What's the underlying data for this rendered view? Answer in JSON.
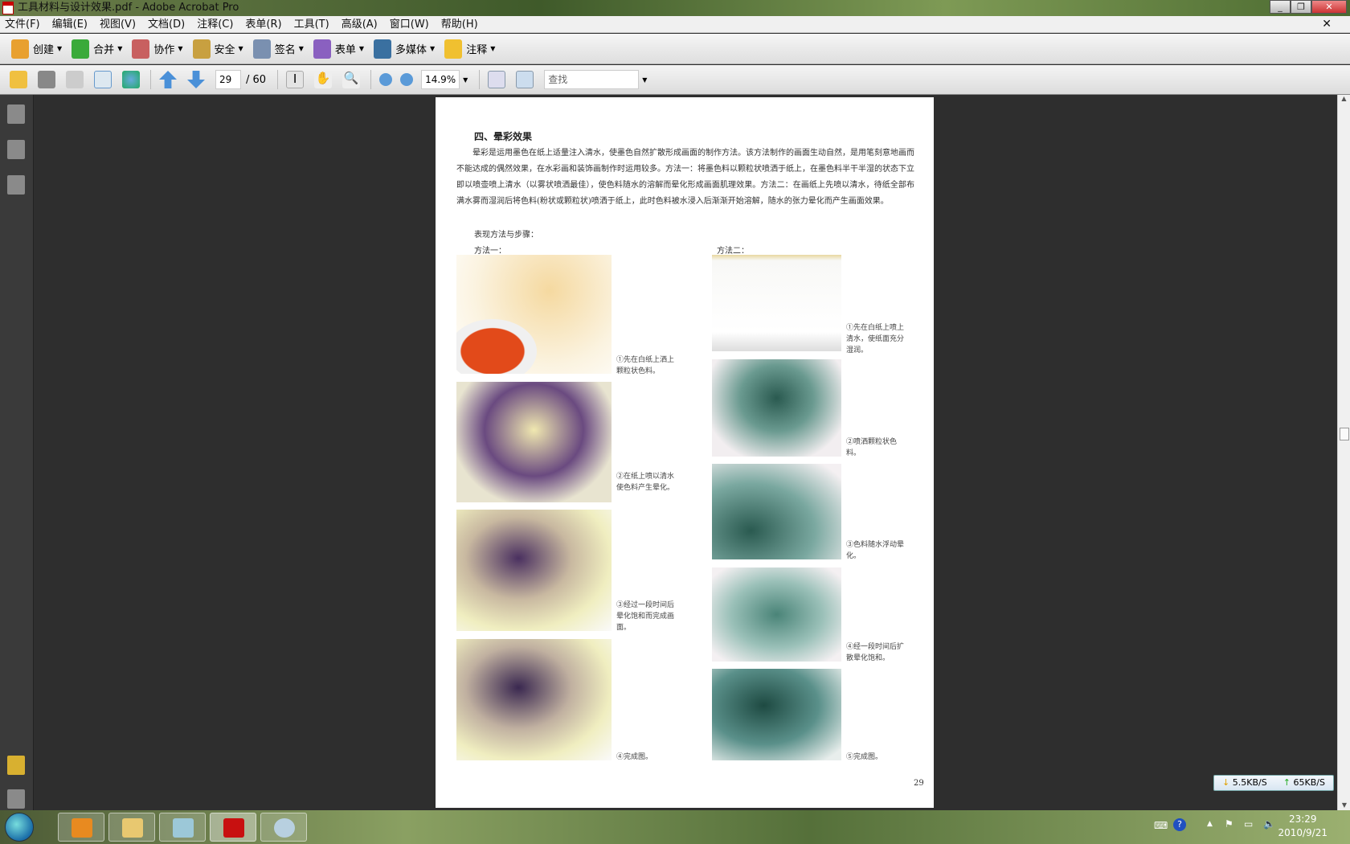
{
  "window": {
    "title": "工具材料与设计效果.pdf - Adobe Acrobat Pro",
    "min": "0",
    "max": "1",
    "close": "r",
    "menu_close": "×"
  },
  "menu": [
    "文件(F)",
    "编辑(E)",
    "视图(V)",
    "文档(D)",
    "注释(C)",
    "表单(R)",
    "工具(T)",
    "高级(A)",
    "窗口(W)",
    "帮助(H)"
  ],
  "toolbar1": [
    {
      "label": "创建",
      "color": "#e8a030"
    },
    {
      "label": "合并",
      "color": "#3aaa3a"
    },
    {
      "label": "协作",
      "color": "#c86060"
    },
    {
      "label": "安全",
      "color": "#c8a040"
    },
    {
      "label": "签名",
      "color": "#7a90b0"
    },
    {
      "label": "表单",
      "color": "#8a60c0"
    },
    {
      "label": "多媒体",
      "color": "#3a70a0"
    },
    {
      "label": "注释",
      "color": "#f0c030"
    }
  ],
  "toolbar2": {
    "page_current": "29",
    "page_total": "/ 60",
    "zoom": "14.9%",
    "find_placeholder": "查找"
  },
  "document": {
    "heading": "四、晕彩效果",
    "paragraph": "晕彩是运用墨色在纸上适量注入清水，使墨色自然扩散形成画面的制作方法。该方法制作的画面生动自然，是用笔刻意地画而不能达成的偶然效果，在水彩画和装饰画制作时运用较多。方法一：将墨色料以颗粒状喷洒于纸上，在墨色料半干半湿的状态下立即以喷壶喷上清水（以雾状喷洒最佳），使色料随水的溶解而晕化形成画面肌理效果。方法二：在画纸上先喷以清水，待纸全部布满水雾而湿润后将色料(粉状或颗粒状)喷洒于纸上，此时色料被水浸入后渐渐开始溶解，随水的张力晕化而产生画面效果。",
    "steps_label": "表现方法与步骤：",
    "method1": {
      "label": "方法一：",
      "captions": [
        "①先在白纸上洒上颗粒状色料。",
        "②在纸上喷以清水使色料产生晕化。",
        "③经过一段时间后晕化饱和而完成画面。",
        "④完成图。"
      ]
    },
    "method2": {
      "label": "方法二：",
      "captions": [
        "①先在白纸上喷上清水，使纸面充分湿润。",
        "②喷洒颗粒状色料。",
        "③色料随水浮动晕化。",
        "④经一段时间后扩散晕化饱和。",
        "⑤完成图。"
      ]
    },
    "page_number": "29"
  },
  "net_speed": {
    "down": "5.5KB/S",
    "up": "65KB/S"
  },
  "clock": {
    "time": "23:29",
    "date": "2010/9/21"
  }
}
